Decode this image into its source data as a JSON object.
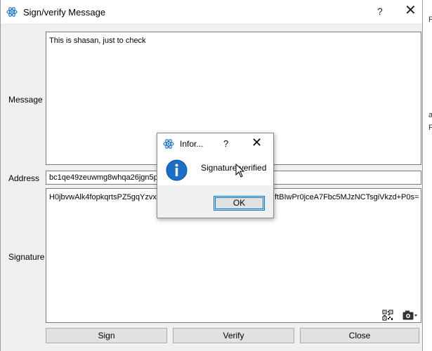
{
  "window": {
    "title": "Sign/verify Message",
    "help": "?",
    "close": "✕"
  },
  "form": {
    "message_label": "Message",
    "message_value": "This is shasan, just to check",
    "address_label": "Address",
    "address_value": "bc1qe49zeuwmg8whqa26jgn5pz",
    "signature_label": "Signature",
    "signature_value_start": "H0jbvwAlk4fopkqrtsPZ5gqYzvxU",
    "signature_value_end": "ftBIwPr0jceA7Fbc5MJzNCTsgiVkzd+P0s="
  },
  "buttons": {
    "sign": "Sign",
    "verify": "Verify",
    "close": "Close"
  },
  "dialog": {
    "title": "Infor...",
    "help": "?",
    "close": "✕",
    "message": "Signature verified",
    "ok": "OK"
  },
  "background_fragments": [
    "F",
    "a",
    "F"
  ],
  "colors": {
    "accent": "#0078d7",
    "info_icon": "#1a6fc9"
  }
}
